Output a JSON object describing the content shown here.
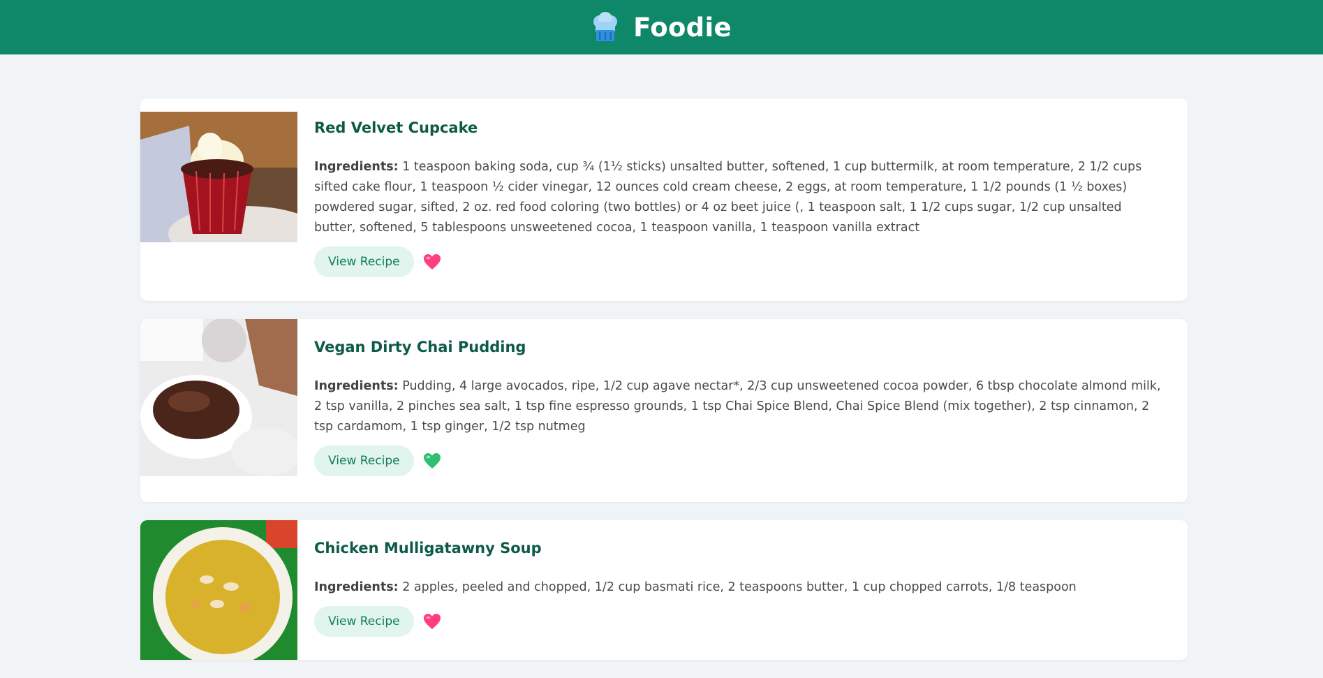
{
  "header": {
    "title": "Foodie",
    "icon": "chef-hat-icon",
    "bg_color": "#0e8868"
  },
  "recipes": [
    {
      "title": "Red Velvet Cupcake",
      "ingredients_label": "Ingredients:",
      "ingredients": "1 teaspoon baking soda, cup ¾ (1½ sticks) unsalted butter, softened, 1 cup buttermilk, at room temperature, 2 1/2 cups sifted cake flour, 1 teaspoon ½ cider vinegar, 12 ounces cold cream cheese, 2 eggs, at room temperature, 1 1/2 pounds (1 ½ boxes) powdered sugar, sifted, 2 oz. red food coloring (two bottles) or 4 oz beet juice (, 1 teaspoon salt, 1 1/2 cups sugar, 1/2 cup unsalted butter, softened, 5 tablespoons unsweetened cocoa, 1 teaspoon vanilla, 1 teaspoon vanilla extract",
      "button_label": "View Recipe",
      "favorite_icon": "heart-pink-icon",
      "favorite_color": "#ff3d7f"
    },
    {
      "title": "Vegan Dirty Chai Pudding",
      "ingredients_label": "Ingredients:",
      "ingredients": "Pudding, 4 large avocados, ripe, 1/2 cup agave nectar*, 2/3 cup unsweetened cocoa powder, 6 tbsp chocolate almond milk, 2 tsp vanilla, 2 pinches sea salt, 1 tsp fine espresso grounds, 1 tsp Chai Spice Blend, Chai Spice Blend (mix together), 2 tsp cinnamon, 2 tsp cardamom, 1 tsp ginger, 1/2 tsp nutmeg",
      "button_label": "View Recipe",
      "favorite_icon": "heart-green-icon",
      "favorite_color": "#2fbf71"
    },
    {
      "title": "Chicken Mulligatawny Soup",
      "ingredients_label": "Ingredients:",
      "ingredients": "2 apples, peeled and chopped, 1/2 cup basmati rice, 2 teaspoons butter, 1 cup chopped carrots, 1/8 teaspoon",
      "button_label": "View Recipe",
      "favorite_icon": "heart-pink-icon",
      "favorite_color": "#ff3d7f"
    }
  ]
}
